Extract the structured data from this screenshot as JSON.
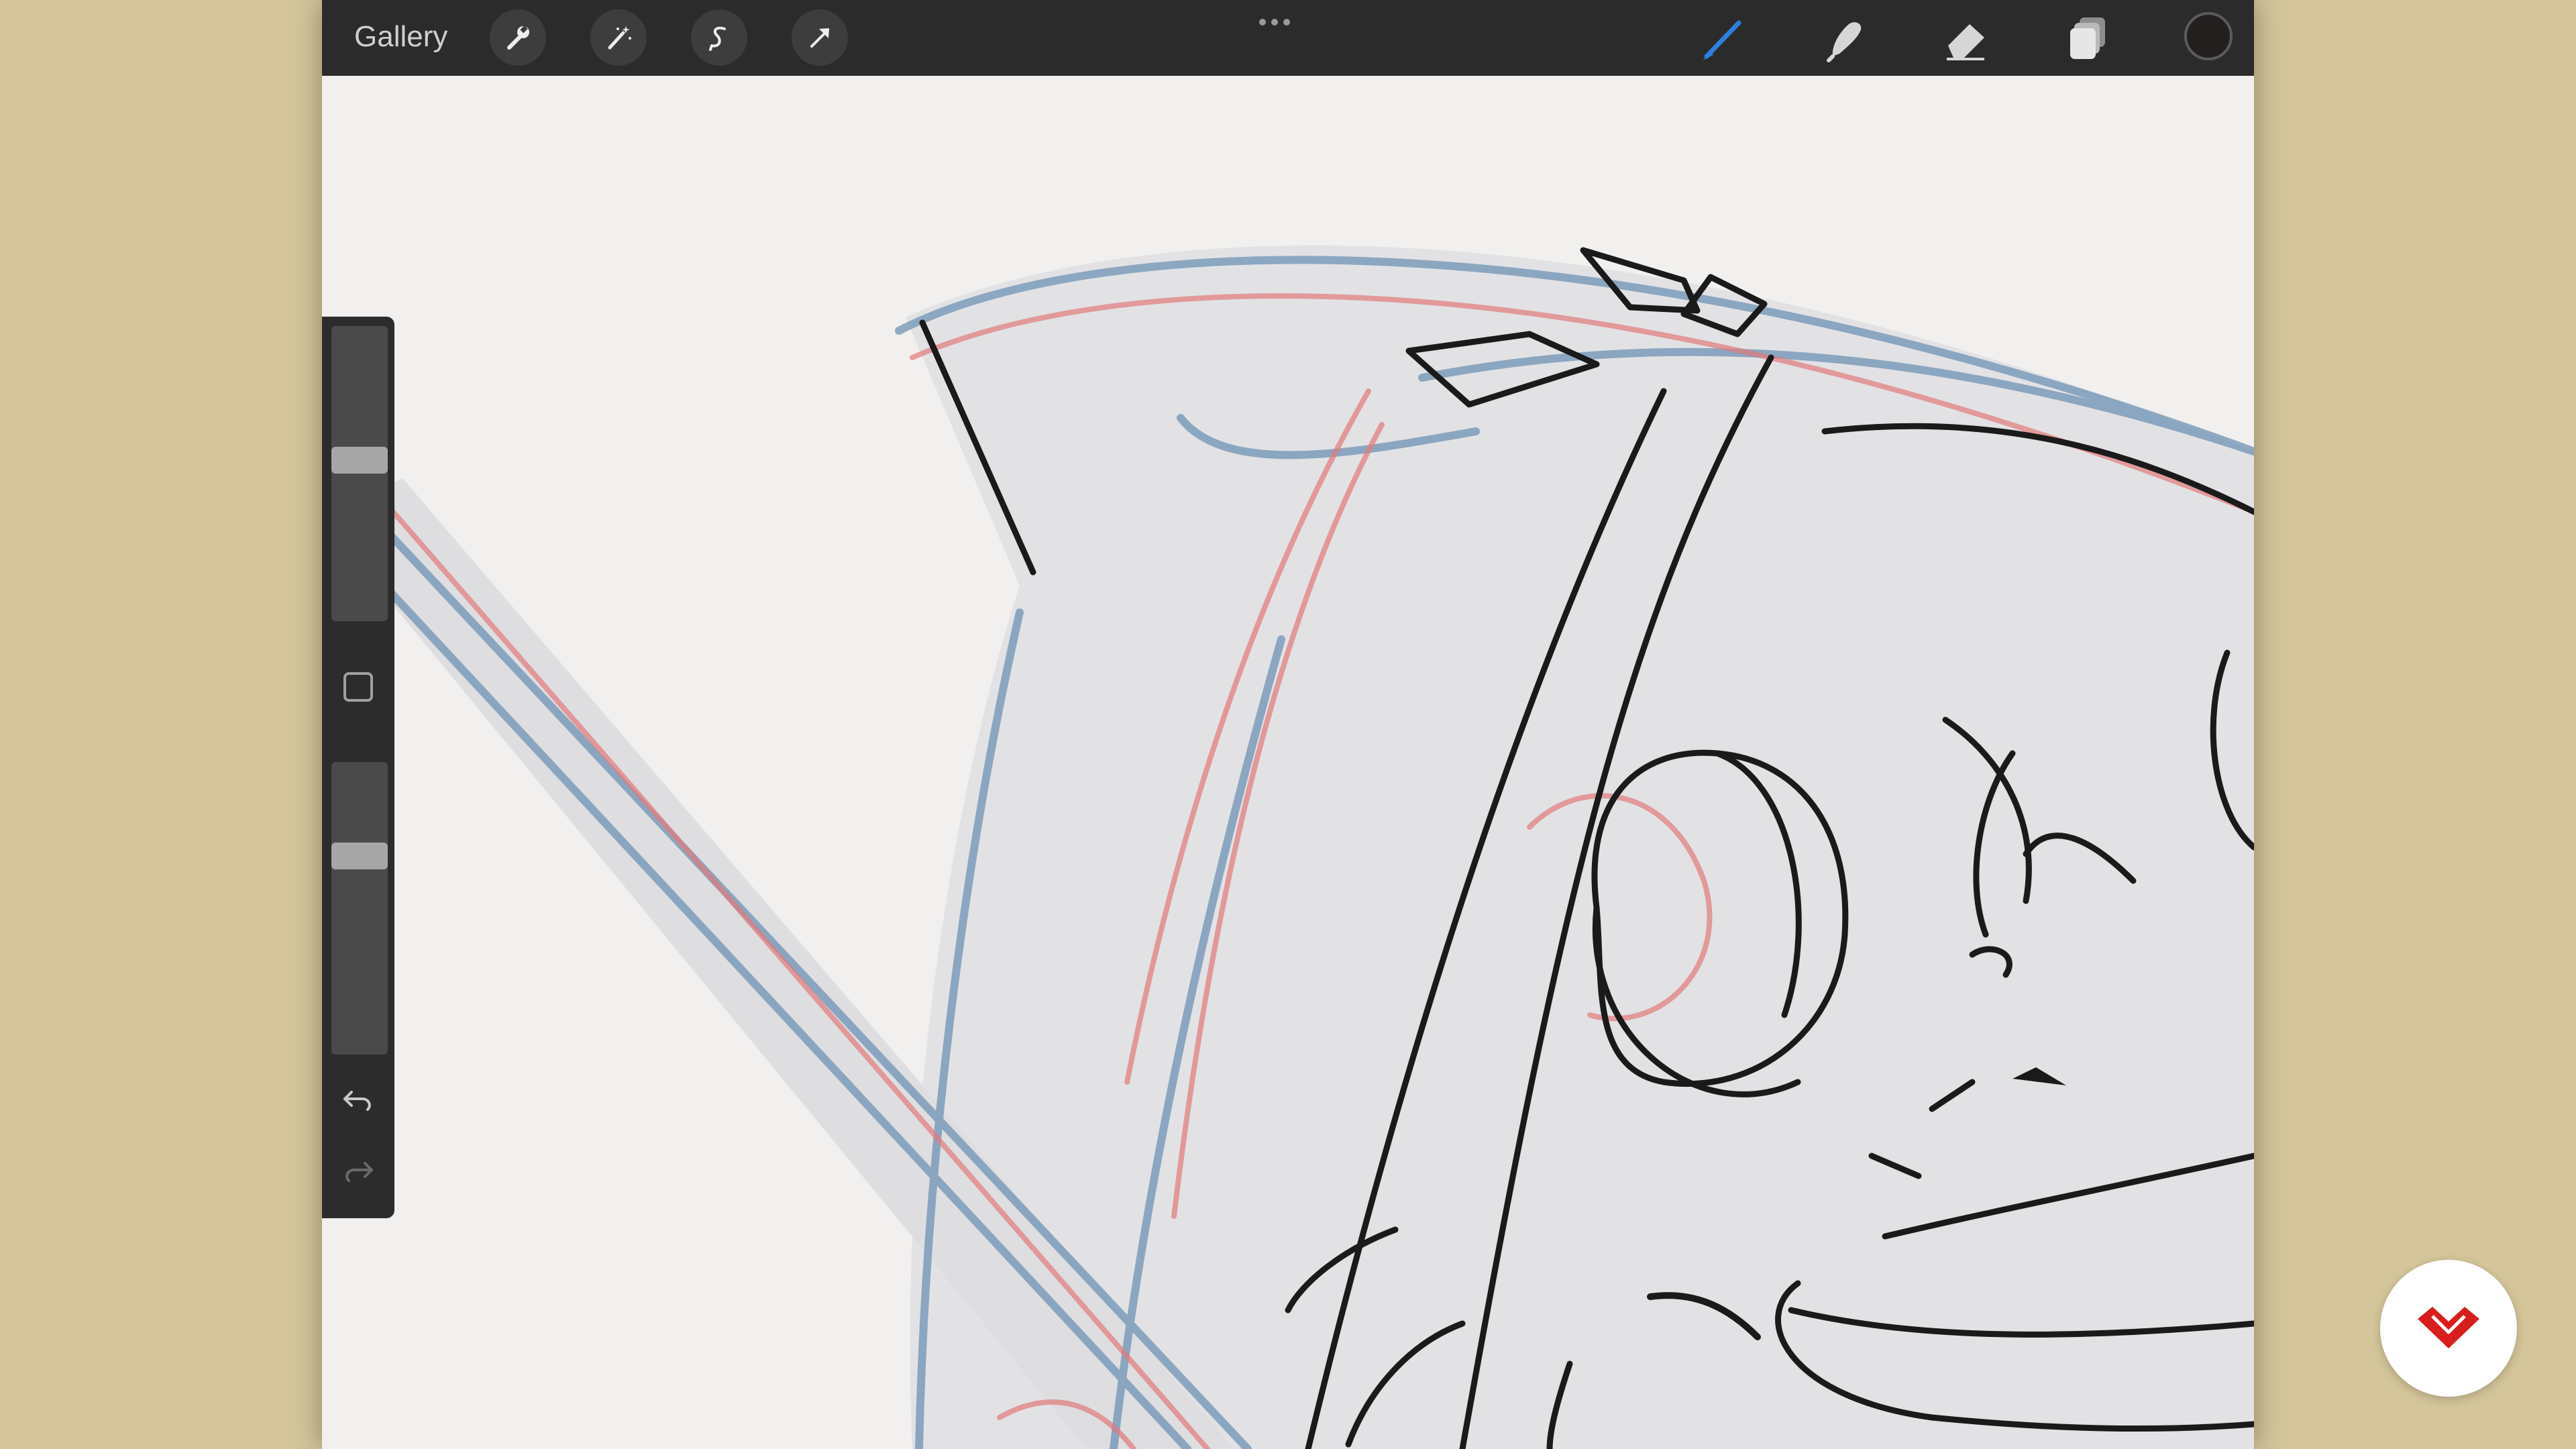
{
  "topbar": {
    "gallery_label": "Gallery",
    "left_tools": [
      "wrench-icon",
      "magic-wand-icon",
      "selection-s-icon",
      "transform-arrow-icon"
    ],
    "right_tools": [
      "brush-icon",
      "smudge-icon",
      "eraser-icon",
      "layers-icon"
    ],
    "active_tool": "brush-icon",
    "current_color": "#231f1f",
    "accent_color": "#2f7fe0"
  },
  "sidebar": {
    "brush_size_level": 0.45,
    "opacity_level": 0.32,
    "controls": [
      "brush-size-slider",
      "modify-square-button",
      "opacity-slider",
      "undo-icon",
      "redo-icon"
    ]
  },
  "canvas": {
    "content": "character-sketch",
    "line_colors": [
      "#1a1a1a",
      "#6f93b4",
      "#e27a7a"
    ]
  },
  "badge": {
    "logo": "heart-logo-icon",
    "color": "#d91c1c"
  }
}
